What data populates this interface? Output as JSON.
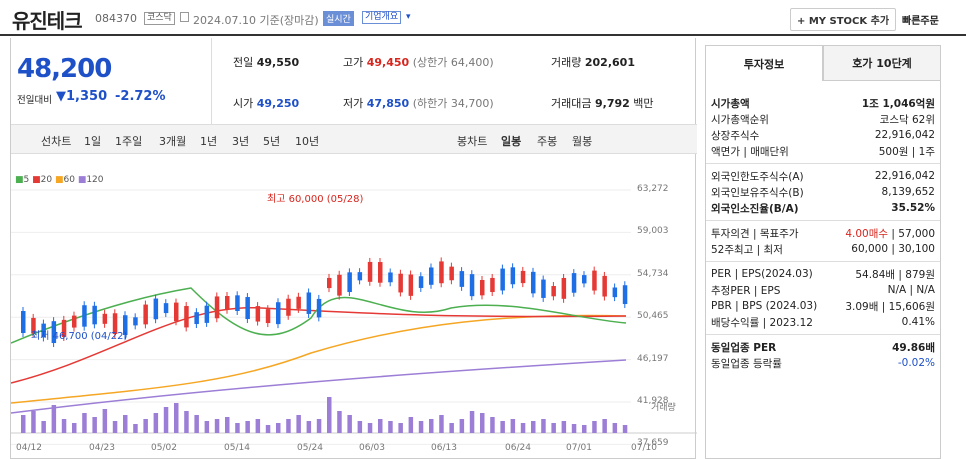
{
  "header": {
    "name": "유진테크",
    "code": "084370",
    "market": "코스닥",
    "date": "2024.07.10 기준(장마감)",
    "realtime": "실시간",
    "company": "기업개요",
    "mystock": "+ MY STOCK 추가",
    "quick": "빠른주문"
  },
  "price": {
    "current": "48,200",
    "change_label": "전일대비",
    "change": "▼1,350",
    "pct": "-2.72%"
  },
  "stats": {
    "prev_label": "전일",
    "prev": "49,550",
    "high_label": "고가",
    "high": "49,450",
    "upper": "(상한가 64,400)",
    "vol_label": "거래량",
    "vol": "202,601",
    "open_label": "시가",
    "open": "49,250",
    "low_label": "저가",
    "low": "47,850",
    "lower": "(하한가 34,700)",
    "amt_label": "거래대금",
    "amt": "9,792",
    "amt_unit": "백만"
  },
  "chart_tabs": {
    "line": "선차트",
    "periods": [
      "1일",
      "1주일",
      "3개월",
      "1년",
      "3년",
      "5년",
      "10년"
    ],
    "candle": "봉차트",
    "c_periods": [
      "일봉",
      "주봉",
      "월봉"
    ]
  },
  "legend": [
    "5",
    "20",
    "60",
    "120"
  ],
  "chart_data": {
    "type": "candlestick",
    "x_ticks": [
      "04/12",
      "04/23",
      "05/02",
      "05/14",
      "05/24",
      "06/03",
      "06/13",
      "06/24",
      "07/01",
      "07/10"
    ],
    "y_ticks": [
      "63,272",
      "59,003",
      "54,734",
      "50,465",
      "46,197",
      "41,928",
      "37,659"
    ],
    "max_label": "최고 60,000 (05/28)",
    "min_label": "최저 46,700 (04/22)",
    "vol_label": "거래량"
  },
  "side": {
    "tab1": "투자정보",
    "tab2": "호가 10단계",
    "rows1": [
      [
        "시가총액",
        "1조 1,046억원"
      ],
      [
        "시가총액순위",
        "코스닥 62위"
      ],
      [
        "상장주식수",
        "22,916,042"
      ],
      [
        "액면가 | 매매단위",
        "500원 | 1주"
      ]
    ],
    "rows2": [
      [
        "외국인한도주식수(A)",
        "22,916,042"
      ],
      [
        "외국인보유주식수(B)",
        "8,139,652"
      ],
      [
        "외국인소진율(B/A)",
        "35.52%"
      ]
    ],
    "rows3": [
      [
        "투자의견 | 목표주가",
        "4.00매수 | 57,000"
      ],
      [
        "52주최고 | 최저",
        "60,000 | 30,100"
      ]
    ],
    "rows4": [
      [
        "PER | EPS(2024.03)",
        "54.84배 | 879원"
      ],
      [
        "추정PER | EPS",
        "N/A | N/A"
      ],
      [
        "PBR | BPS (2024.03)",
        "3.09배 | 15,606원"
      ],
      [
        "배당수익률 | 2023.12",
        "0.41%"
      ]
    ],
    "rows5": [
      [
        "동일업종 PER",
        "49.86배"
      ],
      [
        "동일업종 등락률",
        "-0.02%"
      ]
    ]
  }
}
